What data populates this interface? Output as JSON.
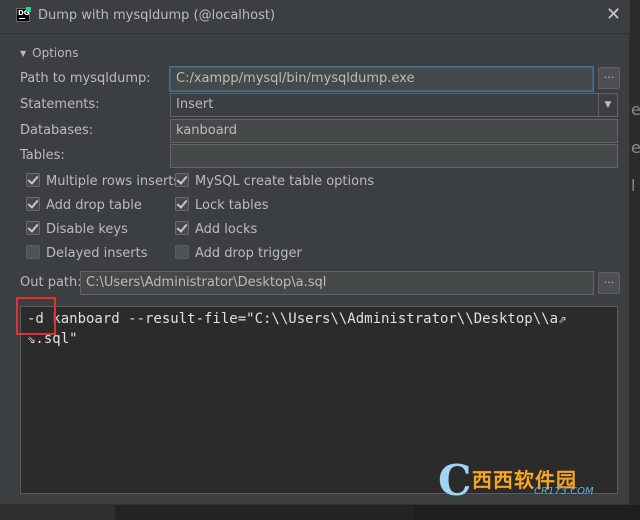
{
  "dialog": {
    "title": "Dump with mysqldump (@localhost)",
    "close_glyph": "✕"
  },
  "options": {
    "header": "Options",
    "path_label": "Path to mysqldump:",
    "path_value": "C:/xampp/mysql/bin/mysqldump.exe",
    "browse_glyph": "...",
    "statements_label": "Statements:",
    "statements_value": "Insert",
    "databases_label": "Databases:",
    "databases_value": "kanboard",
    "tables_label": "Tables:",
    "tables_value": "",
    "checkboxes": [
      {
        "label": "Multiple rows inserts",
        "checked": true
      },
      {
        "label": "MySQL create table options",
        "checked": true
      },
      {
        "label": "Add drop table",
        "checked": true
      },
      {
        "label": "Lock tables",
        "checked": true
      },
      {
        "label": "Disable keys",
        "checked": true
      },
      {
        "label": "Add locks",
        "checked": true
      },
      {
        "label": "Delayed inserts",
        "checked": false
      },
      {
        "label": "Add drop trigger",
        "checked": false
      }
    ],
    "outpath_label": "Out path:",
    "outpath_value": "C:\\Users\\Administrator\\Desktop\\a.sql"
  },
  "command": {
    "line1": "-d kanboard --result-file=\"C:\\\\Users\\\\Administrator\\\\Desktop\\\\a⇗",
    "line2": "⇘.sql\""
  },
  "watermark": {
    "logo": "C",
    "main": "西西软件园",
    "sub": "CR173.COM"
  },
  "colors": {
    "dialog_bg": "#3c3f41",
    "field_bg": "#45494a",
    "text": "#bbbbbb",
    "highlight_box": "#e03030",
    "focus_border": "#466d94"
  }
}
